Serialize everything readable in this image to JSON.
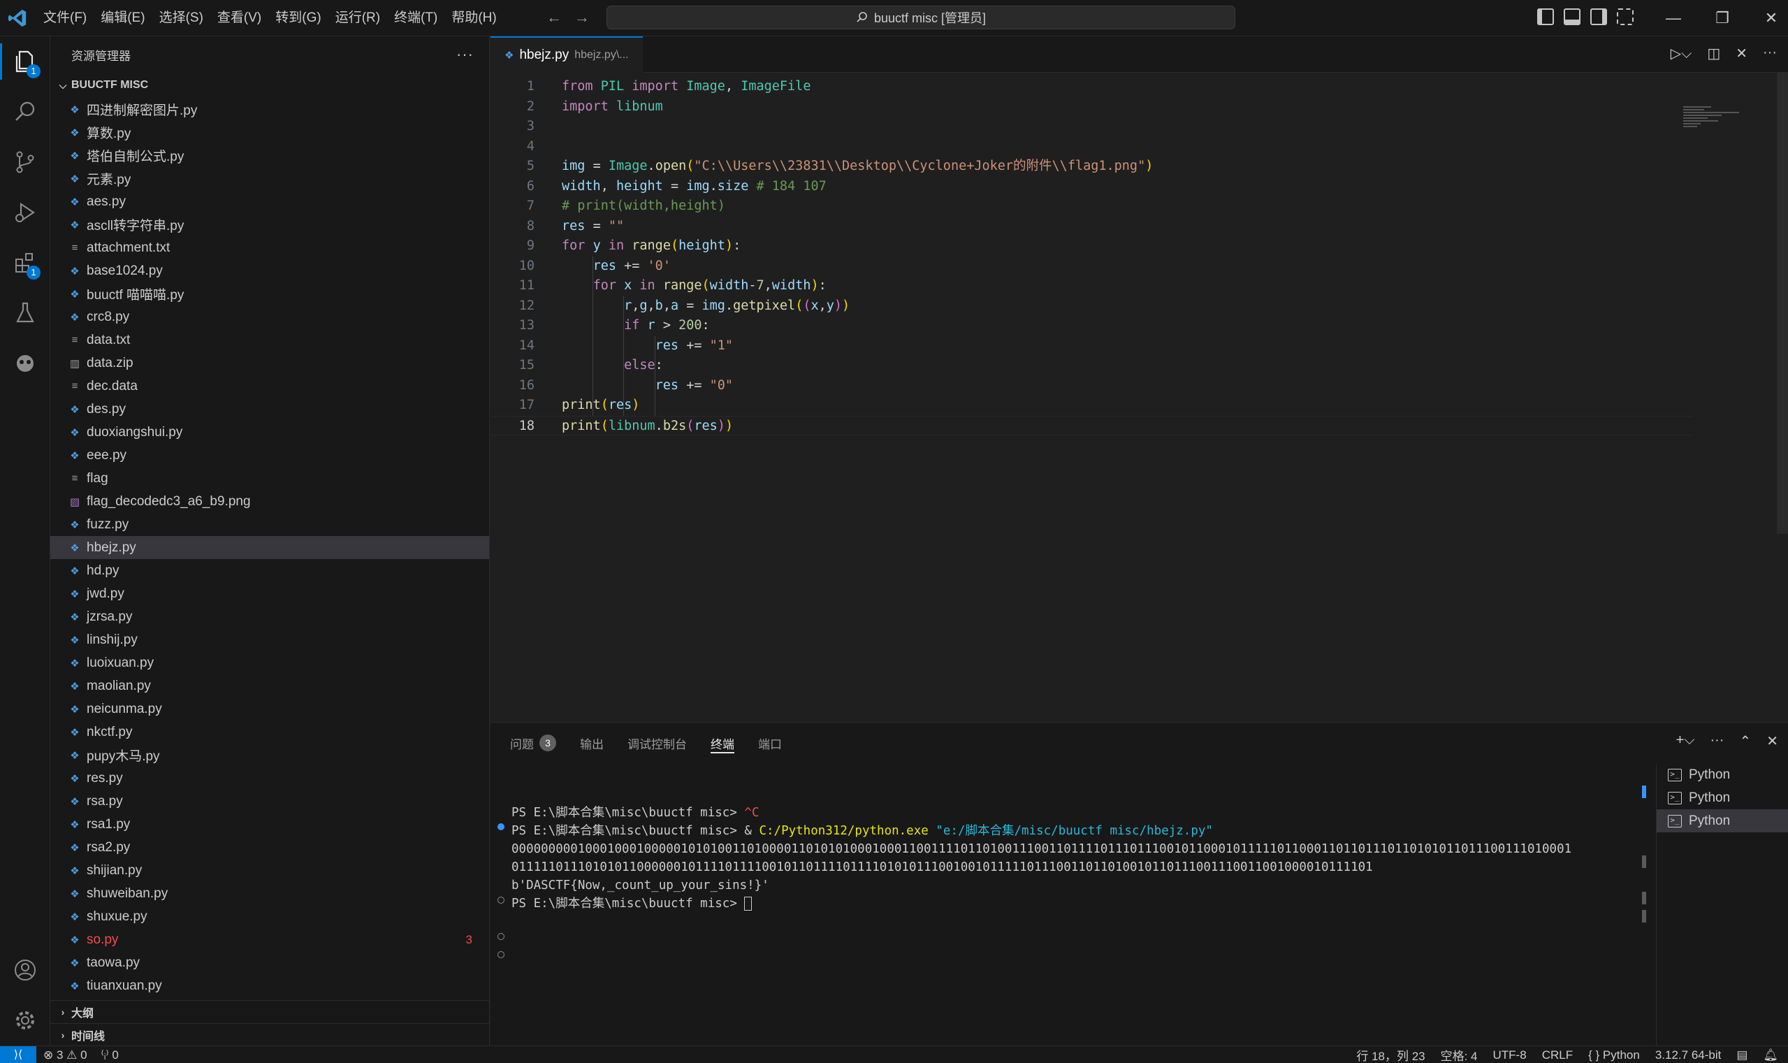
{
  "window": {
    "command_center": "buuctf misc [管理员]",
    "menus": [
      "文件(F)",
      "编辑(E)",
      "选择(S)",
      "查看(V)",
      "转到(G)",
      "运行(R)",
      "终端(T)",
      "帮助(H)"
    ]
  },
  "activity": {
    "explorer_badge": "1",
    "extensions_badge": "1"
  },
  "sidebar": {
    "title": "资源管理器",
    "more": "···",
    "folder": "BUUCTF MISC",
    "files": [
      {
        "name": "四进制解密图片.py",
        "type": "py"
      },
      {
        "name": "算数.py",
        "type": "py"
      },
      {
        "name": "塔伯自制公式.py",
        "type": "py"
      },
      {
        "name": "元素.py",
        "type": "py"
      },
      {
        "name": "aes.py",
        "type": "py"
      },
      {
        "name": "ascll转字符串.py",
        "type": "py"
      },
      {
        "name": "attachment.txt",
        "type": "txt"
      },
      {
        "name": "base1024.py",
        "type": "py"
      },
      {
        "name": "buuctf 喵喵喵.py",
        "type": "py"
      },
      {
        "name": "crc8.py",
        "type": "py"
      },
      {
        "name": "data.txt",
        "type": "txt"
      },
      {
        "name": "data.zip",
        "type": "zip"
      },
      {
        "name": "dec.data",
        "type": "txt"
      },
      {
        "name": "des.py",
        "type": "py"
      },
      {
        "name": "duoxiangshui.py",
        "type": "py"
      },
      {
        "name": "eee.py",
        "type": "py"
      },
      {
        "name": "flag",
        "type": "txt"
      },
      {
        "name": "flag_decodedc3_a6_b9.png",
        "type": "img"
      },
      {
        "name": "fuzz.py",
        "type": "py"
      },
      {
        "name": "hbejz.py",
        "type": "py",
        "selected": true
      },
      {
        "name": "hd.py",
        "type": "py"
      },
      {
        "name": "jwd.py",
        "type": "py"
      },
      {
        "name": "jzrsa.py",
        "type": "py"
      },
      {
        "name": "linshij.py",
        "type": "py"
      },
      {
        "name": "luoixuan.py",
        "type": "py"
      },
      {
        "name": "maolian.py",
        "type": "py"
      },
      {
        "name": "neicunma.py",
        "type": "py"
      },
      {
        "name": "nkctf.py",
        "type": "py"
      },
      {
        "name": "pupy木马.py",
        "type": "py"
      },
      {
        "name": "res.py",
        "type": "py"
      },
      {
        "name": "rsa.py",
        "type": "py"
      },
      {
        "name": "rsa1.py",
        "type": "py"
      },
      {
        "name": "rsa2.py",
        "type": "py"
      },
      {
        "name": "shijian.py",
        "type": "py"
      },
      {
        "name": "shuweiban.py",
        "type": "py"
      },
      {
        "name": "shuxue.py",
        "type": "py"
      },
      {
        "name": "so.py",
        "type": "py",
        "error": true,
        "count": "3"
      },
      {
        "name": "taowa.py",
        "type": "py"
      },
      {
        "name": "tiuanxuan.py",
        "type": "py"
      }
    ],
    "outline": "大纲",
    "timeline": "时间线"
  },
  "editor": {
    "tab_name": "hbejz.py",
    "tab_path": "hbejz.py\\...",
    "current_line": 18,
    "lines": [
      "from PIL import Image, ImageFile",
      "import libnum",
      "",
      "",
      "img = Image.open(\"C:\\\\Users\\\\23831\\\\Desktop\\\\Cyclone+Joker的附件\\\\flag1.png\")",
      "width, height = img.size # 184 107",
      "# print(width,height)",
      "res = \"\"",
      "for y in range(height):",
      "    res += '0'",
      "    for x in range(width-7,width):",
      "        r,g,b,a = img.getpixel((x,y))",
      "        if r > 200:",
      "            res += \"1\"",
      "        else:",
      "            res += \"0\"",
      "print(res)",
      "print(libnum.b2s(res))"
    ]
  },
  "panel": {
    "tabs": [
      {
        "label": "问题",
        "badge": "3"
      },
      {
        "label": "输出"
      },
      {
        "label": "调试控制台"
      },
      {
        "label": "终端",
        "active": true
      },
      {
        "label": "端口"
      }
    ],
    "terminal": [
      "PS E:\\脚本合集\\misc\\buuctf misc> ^C",
      "PS E:\\脚本合集\\misc\\buuctf misc> & C:/Python312/python.exe \"e:/脚本合集/misc/buuctf misc/hbejz.py\"",
      "000000000100010001000001010100110100001101010100010001100111101101001110011011110111011100101100010111110110001101101110110101011011100111010001",
      "011111011101010110000001011110111100101101111011110101011100100101111101110011011010010110111001110011001000010111101",
      "b'DASCTF{Now,_count_up_your_sins!}'",
      "PS E:\\脚本合集\\misc\\buuctf misc> "
    ],
    "terminals": [
      "Python",
      "Python",
      "Python"
    ]
  },
  "status": {
    "errors": "⊗ 3",
    "warnings": "⚠ 0",
    "ports": "⁽ᵢ⁾ 0",
    "position": "行 18，列 23",
    "spaces": "空格: 4",
    "encoding": "UTF-8",
    "eol": "CRLF",
    "language": "{ } Python",
    "interpreter": "3.12.7 64-bit"
  }
}
